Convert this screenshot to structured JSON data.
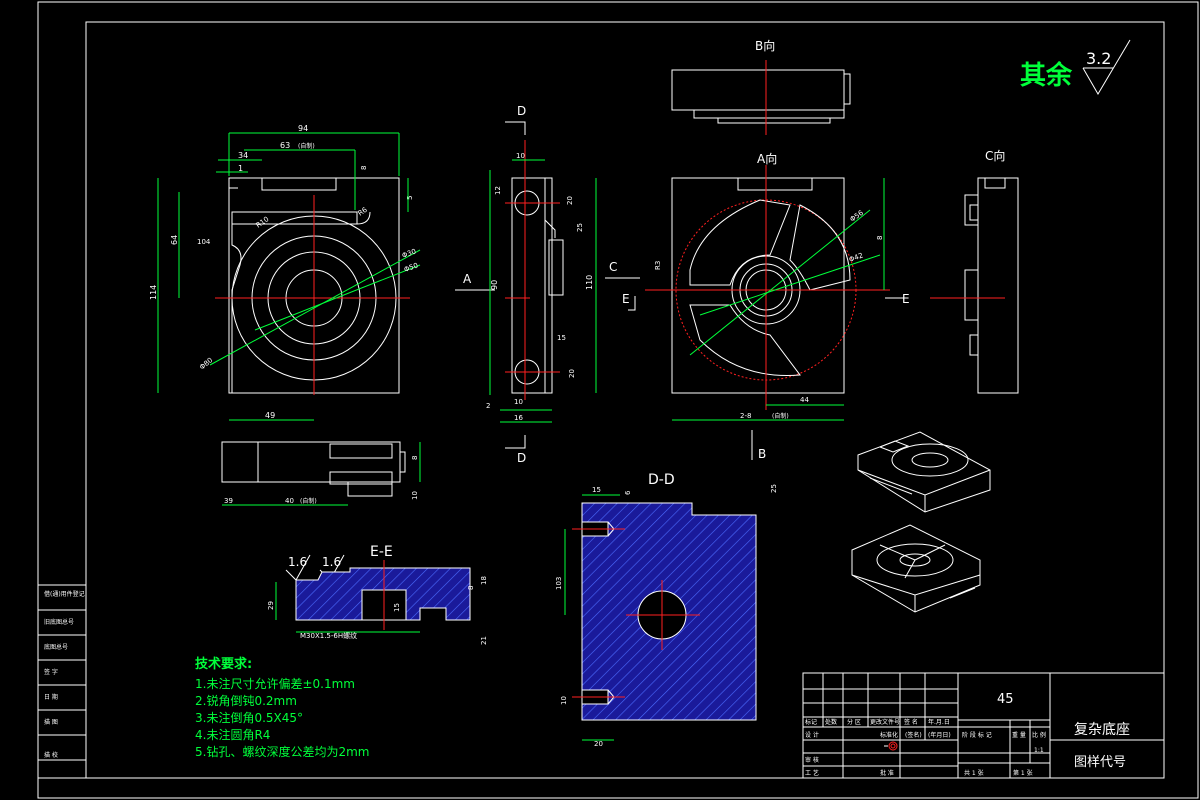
{
  "views": {
    "b_view_title": "B向",
    "a_view_title": "A向",
    "c_view_title": "C向",
    "dd_title": "D-D",
    "ee_title": "E-E"
  },
  "roughness": {
    "label": "其余",
    "value": "3.2",
    "small_value_1": "1.6",
    "small_value_2": "1.6"
  },
  "section_markers": {
    "d_top": "D",
    "d_bottom": "D",
    "a_arrow": "A",
    "c_arrow": "C",
    "e_left_1": "E",
    "e_left_2": "E",
    "e_right": "E",
    "b_arrow": "B"
  },
  "dimensions": {
    "front_width": "94",
    "front_63": "63",
    "front_63_note": "(自制)",
    "front_34": "34",
    "front_1": "1",
    "front_8": "8",
    "front_5": "5",
    "front_r10": "R10",
    "front_r6": "R6",
    "front_64": "64",
    "front_104": "104",
    "front_114": "114",
    "front_d30": "Φ30",
    "front_d50": "Φ50",
    "front_d80": "Φ80",
    "front_49": "49",
    "side_10": "10",
    "side_12": "12",
    "side_20": "20",
    "side_25": "25",
    "side_90": "90",
    "side_110": "110",
    "side_15": "15",
    "side_20b": "20",
    "side_2": "2",
    "side_10b": "10",
    "side_16": "16",
    "top_39": "39",
    "top_40": "40",
    "top_40_note": "(自制)",
    "top_8": "8",
    "top_10": "10",
    "a_d56": "Φ56",
    "a_d42": "Φ42",
    "a_8": "8",
    "a_44": "44",
    "a_r3": "R3",
    "a_2_8": "2-8",
    "a_2_8_note": "(自制)",
    "dd_15": "15",
    "dd_6": "6",
    "dd_25": "25",
    "dd_103": "103",
    "dd_10": "10",
    "dd_20": "20",
    "ee_thread": "M30X1.5-6H螺纹",
    "ee_29": "29",
    "ee_8": "8",
    "ee_15": "15",
    "ee_18": "18",
    "ee_21": "21"
  },
  "tech_requirements": {
    "title": "技术要求:",
    "items": [
      "1.未注尺寸允许偏差±0.1mm",
      "2.锐角倒钝0.2mm",
      "3.未注倒角0.5X45°",
      "4.未注圆角R4",
      "5.钻孔、螺纹深度公差均为2mm"
    ]
  },
  "title_block": {
    "material": "45",
    "part_name": "复杂底座",
    "drawing_code": "图样代号",
    "scale": "1:1",
    "sheet_total": "共 1 张",
    "sheet_no": "第 1 张",
    "headers": [
      "标记",
      "处数",
      "分 区",
      "更改文件号",
      "签 名",
      "年.月.日"
    ],
    "labels": {
      "design": "设 计",
      "std": "标准化",
      "sign_hint": "(签名)",
      "date_hint": "(年月日)",
      "stage": "阶 段 标 记",
      "weight": "重 量",
      "ratio": "比 例",
      "check": "审 核",
      "process": "工 艺",
      "approve": "批 准"
    }
  },
  "left_strip": {
    "items": [
      "借(通)用件登记",
      "旧底图总号",
      "底图总号",
      "签 字",
      "日 期",
      "描 图",
      "描 校"
    ]
  }
}
